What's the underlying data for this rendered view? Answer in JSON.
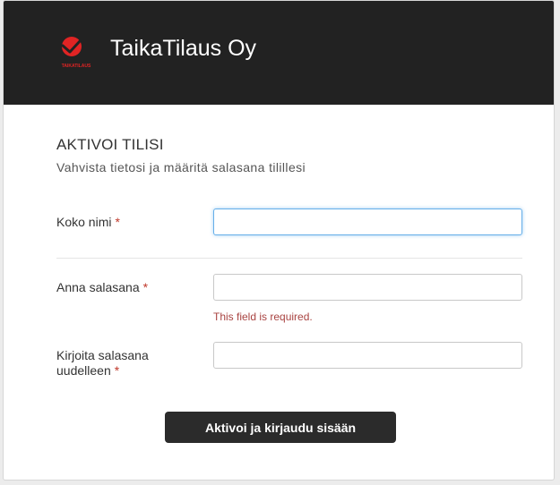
{
  "header": {
    "brand_name": "TaikaTilaus Oy",
    "logo_text": "TAIKATILAUS"
  },
  "form": {
    "title": "AKTIVOI TILISI",
    "subtitle": "Vahvista tietosi ja määritä salasana tilillesi",
    "required_marker": "*",
    "fields": [
      {
        "label": "Koko nimi",
        "value": "",
        "placeholder": ""
      },
      {
        "label": "Anna salasana",
        "value": "",
        "placeholder": "",
        "error": "This field is required."
      },
      {
        "label_line1": "Kirjoita salasana",
        "label_line2": "uudelleen",
        "value": "",
        "placeholder": ""
      }
    ],
    "submit_label": "Aktivoi ja kirjaudu sisään"
  },
  "colors": {
    "header_bg": "#222222",
    "logo_red": "#e02424",
    "required": "#c0392b",
    "error": "#a94442",
    "button_bg": "#2b2b2b",
    "focus_border": "#66afe9"
  }
}
